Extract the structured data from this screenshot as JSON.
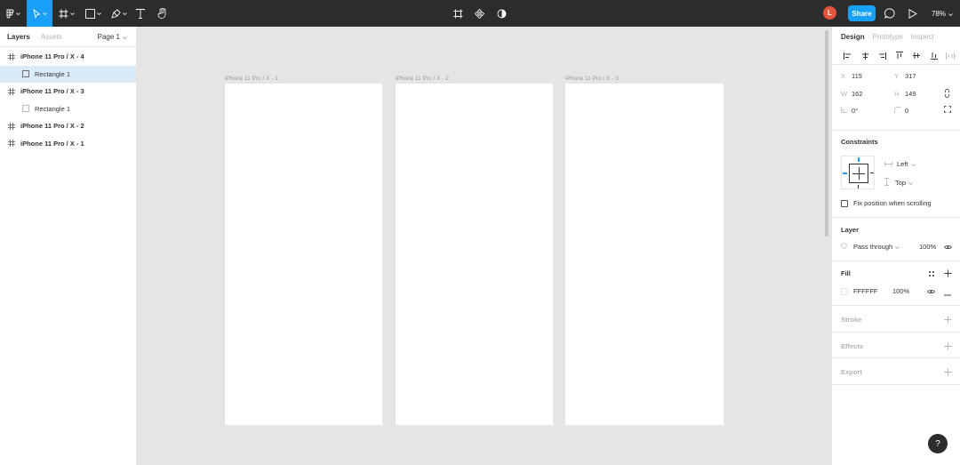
{
  "toolbar": {
    "zoom": "78%",
    "share_label": "Share",
    "avatar_initial": "L"
  },
  "left_panel": {
    "tabs": [
      {
        "label": "Layers",
        "active": true
      },
      {
        "label": "Assets",
        "active": false
      }
    ],
    "page": "Page 1",
    "layers": [
      {
        "label": "iPhone 11 Pro / X - 4",
        "type": "frame",
        "selected": false
      },
      {
        "label": "Rectangle 1",
        "type": "rect",
        "selected": true
      },
      {
        "label": "iPhone 11 Pro / X - 3",
        "type": "frame",
        "selected": false
      },
      {
        "label": "Rectangle 1",
        "type": "rect",
        "selected": false
      },
      {
        "label": "iPhone 11 Pro / X - 2",
        "type": "frame",
        "selected": false
      },
      {
        "label": "iPhone 11 Pro / X - 1",
        "type": "frame",
        "selected": false
      }
    ]
  },
  "canvas": {
    "frames": [
      {
        "label": "iPhone 11 Pro / X - 1"
      },
      {
        "label": "iPhone 11 Pro / X - 2"
      },
      {
        "label": "iPhone 11 Pro / X - 3"
      }
    ]
  },
  "right_panel": {
    "tabs": [
      {
        "label": "Design",
        "active": true
      },
      {
        "label": "Prototype",
        "active": false
      },
      {
        "label": "Inspect",
        "active": false
      }
    ],
    "props": {
      "x_label": "X",
      "x": "115",
      "y_label": "Y",
      "y": "317",
      "w_label": "W",
      "w": "162",
      "h_label": "H",
      "h": "149",
      "rotation": "0°",
      "radius": "0"
    },
    "constraints": {
      "title": "Constraints",
      "horizontal": "Left",
      "vertical": "Top",
      "fix_label": "Fix position when scrolling"
    },
    "layer": {
      "title": "Layer",
      "blend": "Pass through",
      "opacity": "100%"
    },
    "fill": {
      "title": "Fill",
      "hex": "FFFFFF",
      "opacity": "100%"
    },
    "stroke_title": "Stroke",
    "effects_title": "Effects",
    "export_title": "Export"
  },
  "help_label": "?",
  "colors": {
    "toolbar_bg": "#2c2c2c",
    "accent": "#18a0fb",
    "avatar": "#e5533d",
    "selected_row": "#daebf7",
    "canvas": "#e5e5e5"
  }
}
